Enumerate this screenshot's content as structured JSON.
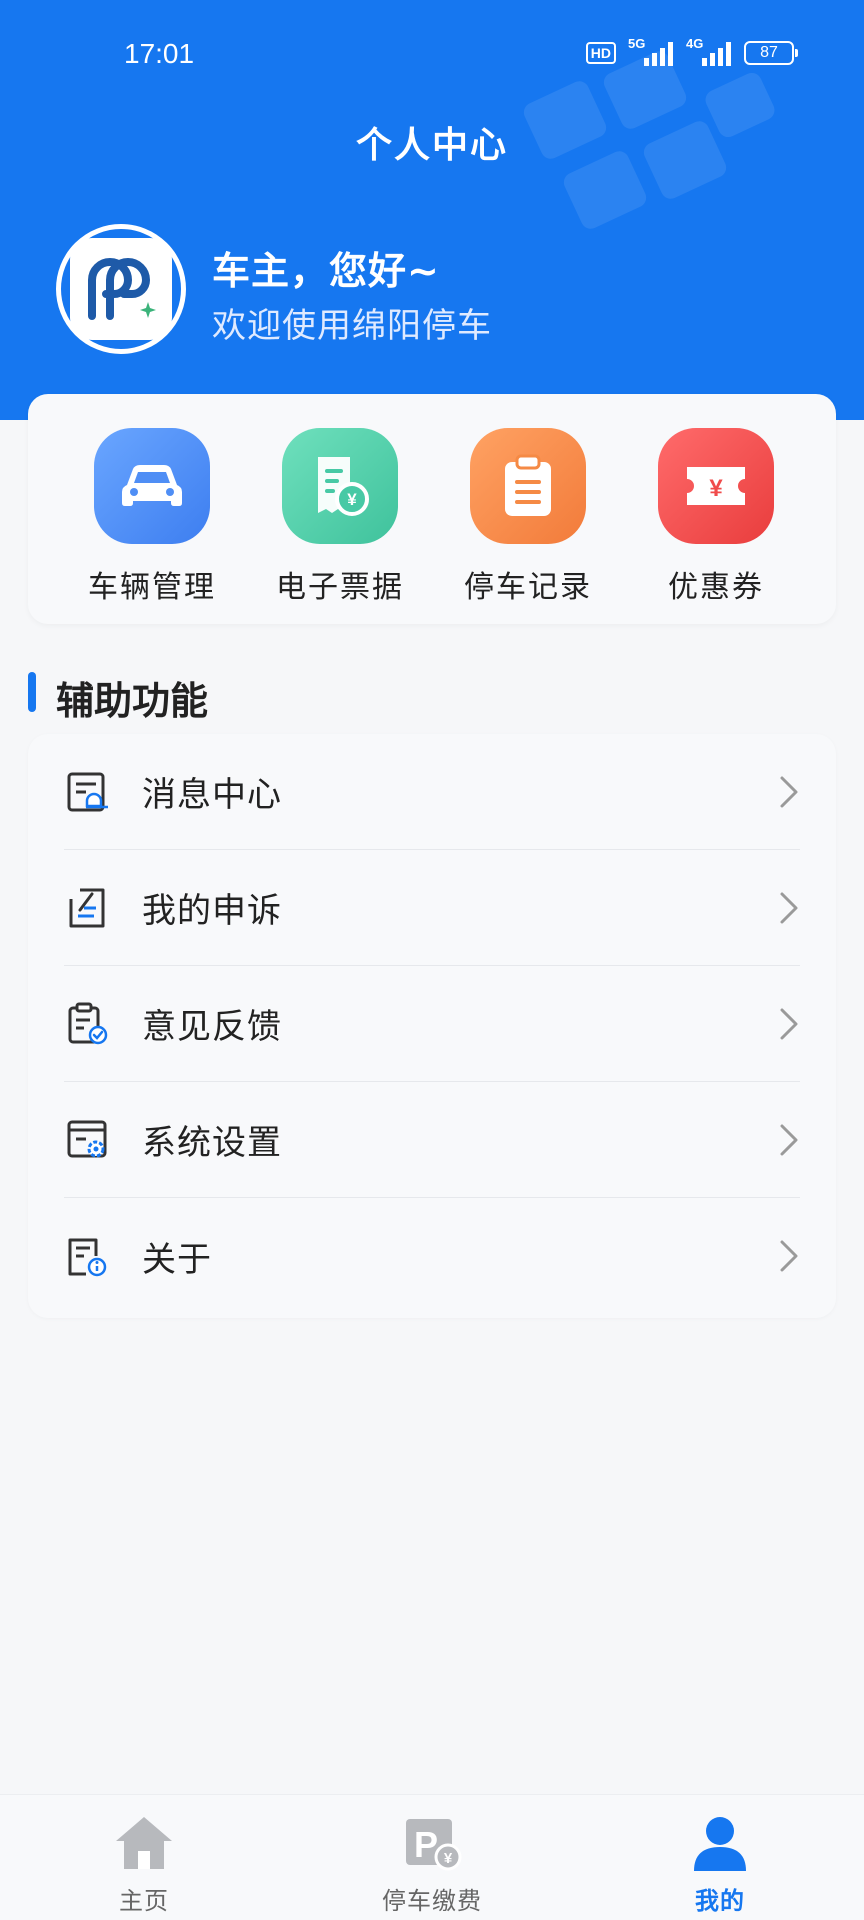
{
  "status_bar": {
    "time": "17:01",
    "hd_label": "HD",
    "net1_label": "5G",
    "net2_label": "4G",
    "battery": "87"
  },
  "header": {
    "title": "个人中心",
    "greeting": "车主，您好~",
    "welcome": "欢迎使用绵阳停车",
    "background_color": "#1677f0"
  },
  "quick_actions": [
    {
      "label": "车辆管理",
      "icon": "car-icon",
      "color": "#4f8ef5"
    },
    {
      "label": "电子票据",
      "icon": "receipt-icon",
      "color": "#47c9a5"
    },
    {
      "label": "停车记录",
      "icon": "clipboard-icon",
      "color": "#f58a45"
    },
    {
      "label": "优惠券",
      "icon": "coupon-icon",
      "color": "#f04b4b"
    }
  ],
  "section": {
    "title": "辅助功能"
  },
  "menu": [
    {
      "label": "消息中心",
      "icon": "message-bell-icon"
    },
    {
      "label": "我的申诉",
      "icon": "appeal-icon"
    },
    {
      "label": "意见反馈",
      "icon": "feedback-icon"
    },
    {
      "label": "系统设置",
      "icon": "settings-icon"
    },
    {
      "label": "关于",
      "icon": "about-icon"
    }
  ],
  "tabbar": {
    "items": [
      {
        "label": "主页",
        "icon": "home-icon",
        "active": false
      },
      {
        "label": "停车缴费",
        "icon": "parking-pay-icon",
        "active": false
      },
      {
        "label": "我的",
        "icon": "user-icon",
        "active": true
      }
    ],
    "active_color": "#1677f0"
  }
}
